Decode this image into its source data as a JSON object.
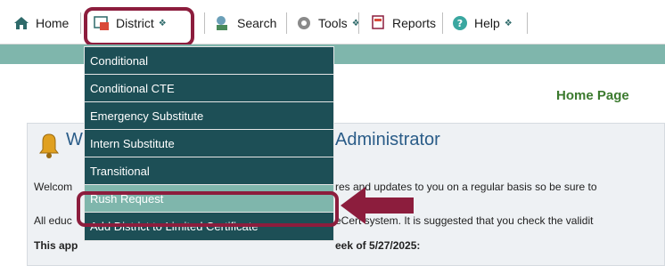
{
  "menubar": {
    "home": "Home",
    "district": "District",
    "search": "Search",
    "tools": "Tools",
    "reports": "Reports",
    "help": "Help"
  },
  "main": {
    "home_page": "Home Page",
    "welcome_title_start": "W",
    "welcome_title_end": "Administrator",
    "line1_start": "Welcom",
    "line1_end": "res and updates to you on a regular basis so be sure to",
    "line2_start": "All educ",
    "line2_end": "eCert system. It is suggested that you check the validit",
    "line3_start": "This app",
    "line3_end": "eek of 5/27/2025:"
  },
  "dropdown": {
    "items": [
      "Conditional",
      "Conditional CTE",
      "Emergency Substitute",
      "Intern Substitute",
      "Transitional",
      "Rush Request",
      "Add District to Limited Certificate"
    ],
    "active_index": 5
  },
  "colors": {
    "menu_dark": "#1d4f56",
    "menu_active": "#7fb6ac",
    "highlight": "#8c1d3d",
    "home_page_green": "#3b7a2e",
    "welcome_blue": "#2a5c88"
  },
  "icons": {
    "home": "home-icon",
    "district": "district-icon",
    "search": "search-icon",
    "tools": "tools-icon",
    "reports": "reports-icon",
    "help": "help-icon",
    "welcome": "bell-icon",
    "annotation": "arrow-icon"
  }
}
